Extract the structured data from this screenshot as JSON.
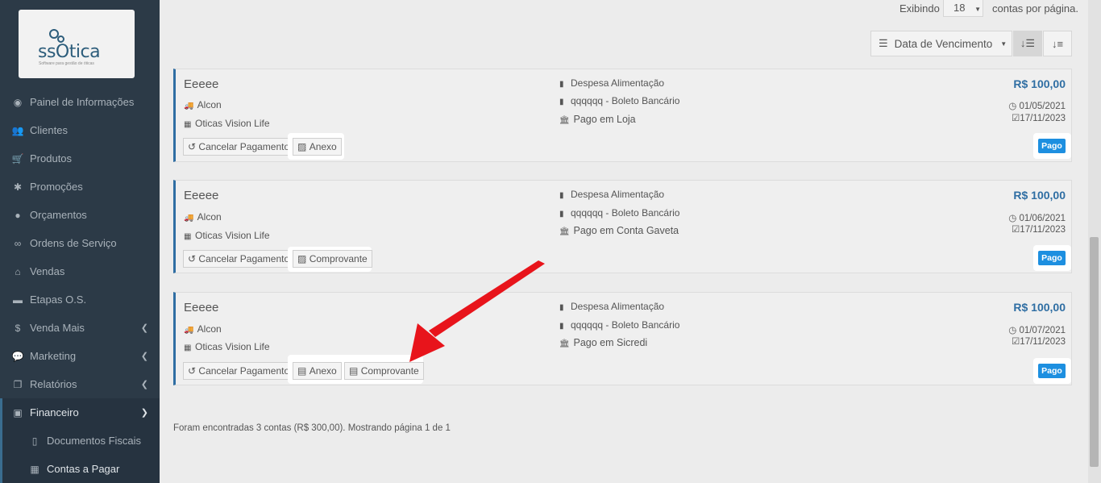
{
  "brand": {
    "name": "ssOtica",
    "tagline": "Software para gestão de óticas"
  },
  "sidebar": {
    "items": [
      {
        "label": "Painel de Informações",
        "icon": "dashboard-icon"
      },
      {
        "label": "Clientes",
        "icon": "users-icon"
      },
      {
        "label": "Produtos",
        "icon": "cart-icon"
      },
      {
        "label": "Promoções",
        "icon": "asterisk-icon"
      },
      {
        "label": "Orçamentos",
        "icon": "user-circle-icon"
      },
      {
        "label": "Ordens de Serviço",
        "icon": "glasses-icon"
      },
      {
        "label": "Vendas",
        "icon": "basket-icon"
      },
      {
        "label": "Etapas O.S.",
        "icon": "card-icon"
      },
      {
        "label": "Venda Mais",
        "icon": "dollar-icon"
      },
      {
        "label": "Marketing",
        "icon": "comments-icon"
      },
      {
        "label": "Relatórios",
        "icon": "copy-icon"
      },
      {
        "label": "Financeiro",
        "icon": "money-icon"
      },
      {
        "label": "Documentos Fiscais",
        "icon": "file-icon"
      },
      {
        "label": "Contas a Pagar",
        "icon": "calculator-icon"
      }
    ]
  },
  "toolbar": {
    "showing_label": "Exibindo",
    "per_page_value": "18",
    "per_page_suffix": "contas por página.",
    "sort_label": "Data de Vencimento"
  },
  "cards": [
    {
      "title": "Eeeee",
      "supplier": "Alcon",
      "store": "Oticas Vision Life",
      "category": "Despesa Alimentação",
      "document": "qqqqqq - Boleto Bancário",
      "payment_place": "Pago em Loja",
      "amount": "R$ 100,00",
      "due_date": "01/05/2021",
      "paid_date": "17/11/2023",
      "cancel_label": "Cancelar Pagamento",
      "attachments": [
        "Anexo"
      ],
      "status": "Pago"
    },
    {
      "title": "Eeeee",
      "supplier": "Alcon",
      "store": "Oticas Vision Life",
      "category": "Despesa Alimentação",
      "document": "qqqqqq - Boleto Bancário",
      "payment_place": "Pago em Conta Gaveta",
      "amount": "R$ 100,00",
      "due_date": "01/06/2021",
      "paid_date": "17/11/2023",
      "cancel_label": "Cancelar Pagamento",
      "attachments": [
        "Comprovante"
      ],
      "status": "Pago"
    },
    {
      "title": "Eeeee",
      "supplier": "Alcon",
      "store": "Oticas Vision Life",
      "category": "Despesa Alimentação",
      "document": "qqqqqq - Boleto Bancário",
      "payment_place": "Pago em Sicredi",
      "amount": "R$ 100,00",
      "due_date": "01/07/2021",
      "paid_date": "17/11/2023",
      "cancel_label": "Cancelar Pagamento",
      "attachments": [
        "Anexo",
        "Comprovante"
      ],
      "status": "Pago"
    }
  ],
  "footer": {
    "summary": "Foram encontradas 3 contas (R$ 300,00). Mostrando página 1 de 1"
  },
  "colors": {
    "accent": "#2f6ea3",
    "badge": "#1d8fe0",
    "sidebar": "#2c3a47",
    "arrow": "#e8141b"
  }
}
